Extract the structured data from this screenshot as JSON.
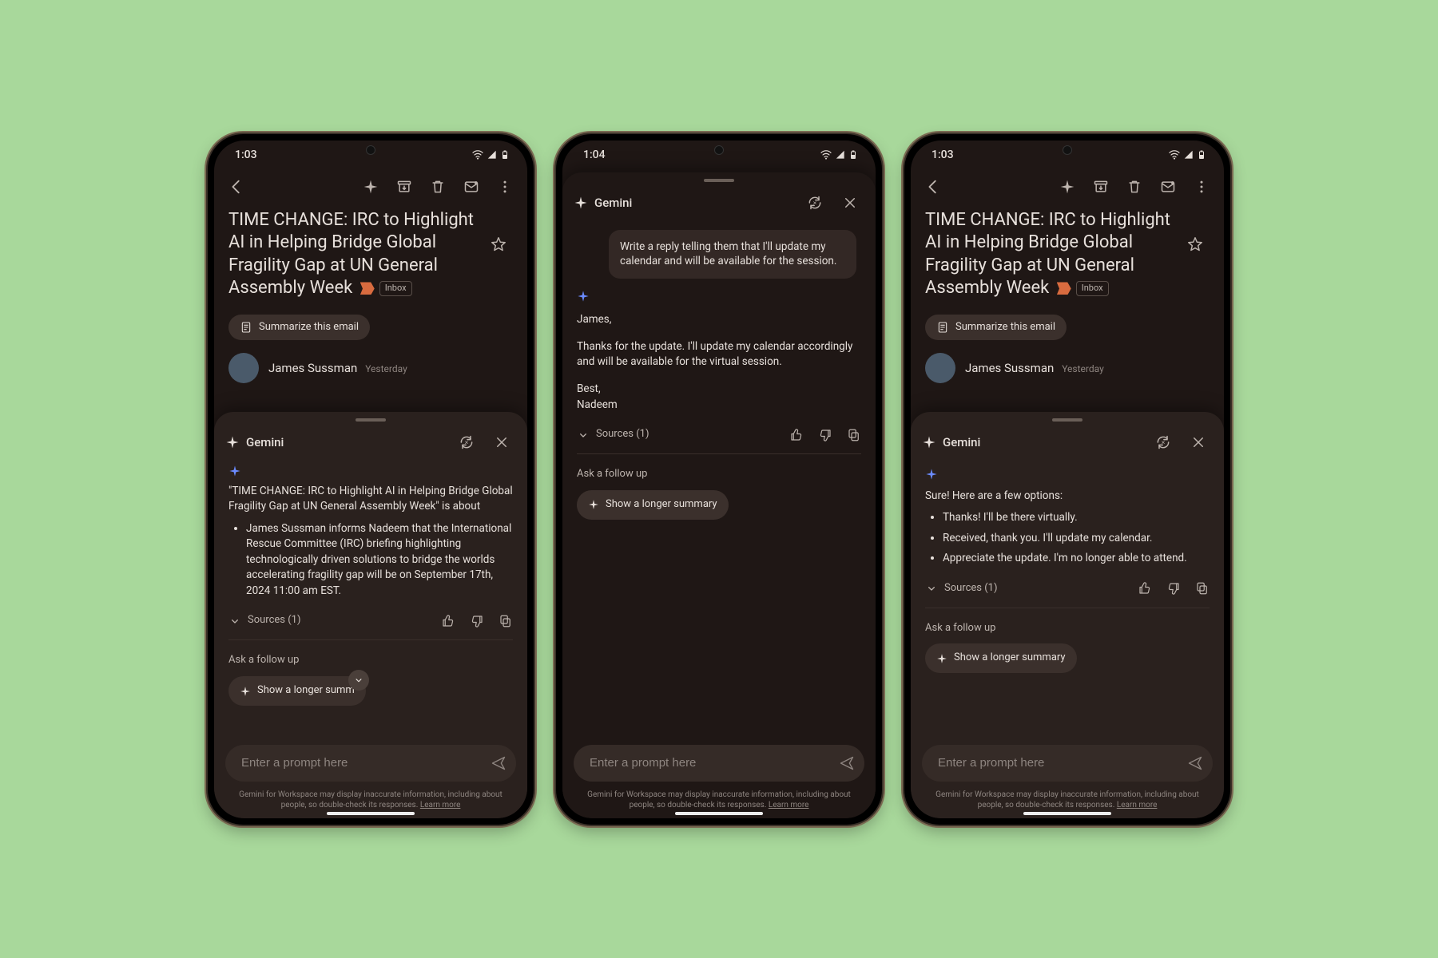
{
  "status": {
    "time_a": "1:03",
    "time_b": "1:04"
  },
  "toolbar_icons": {
    "back": "back-arrow-icon",
    "spark": "gemini-spark-icon",
    "archive": "archive-icon",
    "delete": "trash-icon",
    "mail": "mark-unread-icon",
    "more": "more-vert-icon"
  },
  "email": {
    "subject": "TIME CHANGE: IRC to Highlight AI in Helping Bridge Global Fragility Gap at UN General Assembly Week",
    "inbox_label": "Inbox",
    "summarize_chip": "Summarize this email",
    "sender": "James Sussman",
    "sender_time": "Yesterday"
  },
  "panel": {
    "title": "Gemini",
    "sources": "Sources (1)",
    "followup": "Ask a follow up",
    "suggestion_full": "Show a longer summary",
    "suggestion_trunc": "Show a longer summ",
    "prompt_placeholder": "Enter a prompt here",
    "disclaimer_a": "Gemini for Workspace may display inaccurate information, including about people, so double-check its responses. ",
    "disclaimer_b": "Learn more"
  },
  "screen1": {
    "intro": "\"TIME CHANGE: IRC to Highlight AI in Helping Bridge Global Fragility Gap at UN General Assembly Week\" is about",
    "bullet": "James Sussman informs Nadeem that the International Rescue Committee (IRC) briefing highlighting technologically driven solutions to bridge the worlds accelerating fragility gap will be on September 17th, 2024 11:00 am EST."
  },
  "screen2": {
    "user_prompt": "Write a reply telling them that I'll update my calendar and will be available for the session.",
    "reply_greet": "James,",
    "reply_body": "Thanks for the update. I'll update my calendar accordingly and will be available for the virtual session.",
    "reply_signoff1": "Best,",
    "reply_signoff2": "Nadeem"
  },
  "screen3": {
    "intro": "Sure! Here are a few options:",
    "opts": [
      "Thanks! I'll be there virtually.",
      "Received, thank you. I'll update my calendar.",
      "Appreciate the update. I'm no longer able to attend."
    ]
  }
}
